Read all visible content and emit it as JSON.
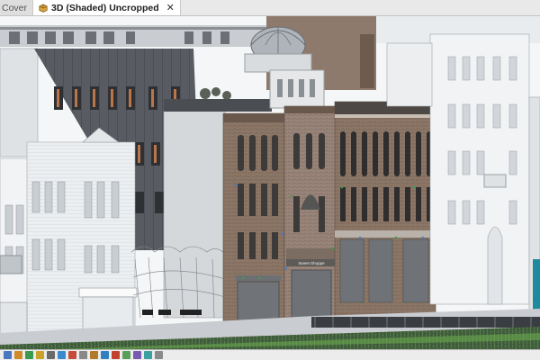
{
  "tabs": [
    {
      "label": "Cover",
      "active": false
    },
    {
      "label": "3D (Shaded) Uncropped",
      "active": true,
      "close": "✕"
    }
  ],
  "viewport": {
    "storefront_sign": "Sweet Shoppe"
  },
  "view_controls": [
    {
      "icon": "scale-icon",
      "color": "#4a78c0"
    },
    {
      "icon": "detail-level-icon",
      "color": "#d08a2a"
    },
    {
      "icon": "visual-style-icon",
      "color": "#3b9a4d"
    },
    {
      "icon": "sun-path-icon",
      "color": "#c9a227"
    },
    {
      "icon": "shadows-icon",
      "color": "#6a6a6a"
    },
    {
      "icon": "render-icon",
      "color": "#3a8ad0"
    },
    {
      "icon": "crop-icon",
      "color": "#c44a3a"
    },
    {
      "icon": "show-crop-icon",
      "color": "#888888"
    },
    {
      "icon": "lock-view-icon",
      "color": "#b07a2a"
    },
    {
      "icon": "temporary-hide-icon",
      "color": "#2f7fc1"
    },
    {
      "icon": "reveal-hidden-icon",
      "color": "#c2402f"
    },
    {
      "icon": "worksharing-icon",
      "color": "#5a9e5a"
    },
    {
      "icon": "highlight-displacement-icon",
      "color": "#7a5ab0"
    },
    {
      "icon": "analytical-model-icon",
      "color": "#3aa0a0"
    },
    {
      "icon": "constraints-icon",
      "color": "#8a8a8a"
    }
  ]
}
